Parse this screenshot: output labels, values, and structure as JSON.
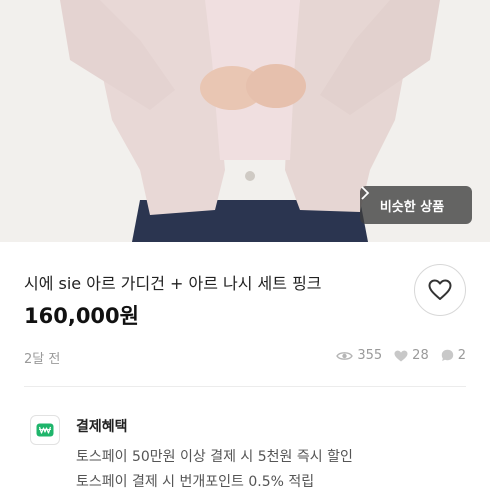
{
  "photo": {
    "alt_icon": "product-photo",
    "similar_button_label": "비슷한 상품",
    "similar_button_icon": "chevron-right-icon"
  },
  "product": {
    "title": "시에 sie 아르 가디건 + 아르 나시 세트 핑크",
    "price": "160,000원"
  },
  "meta": {
    "time_ago": "2달 전",
    "views": "355",
    "likes": "28",
    "chats": "2"
  },
  "benefits": {
    "title": "결제혜택",
    "icon": "won-icon",
    "lines": [
      "토스페이 50만원 이상 결제 시 5천원 즉시 할인",
      "토스페이 결제 시 번개포인트 0.5% 적립"
    ]
  },
  "colors": {
    "accent_green": "#1fb56b",
    "muted_gray": "#9a9a9a"
  }
}
